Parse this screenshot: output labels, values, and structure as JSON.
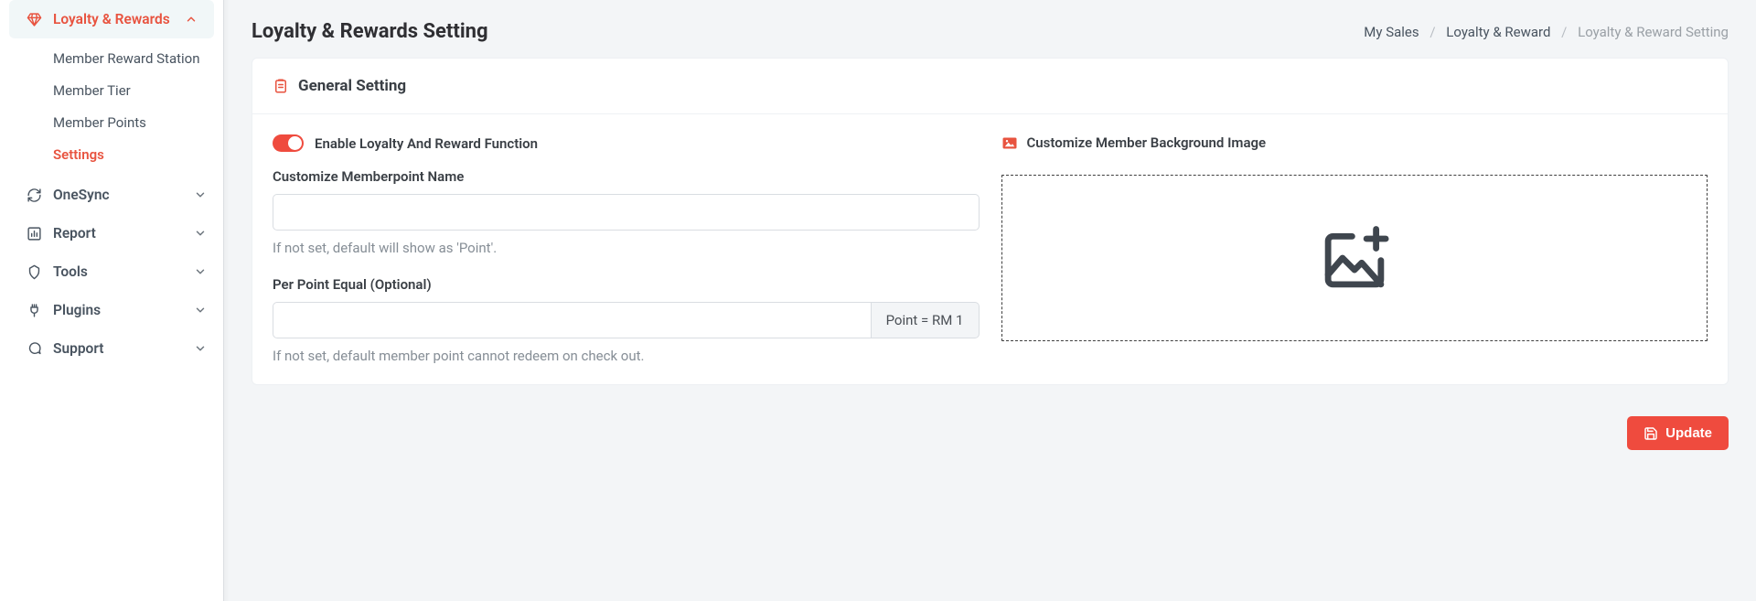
{
  "sidebar": {
    "groups": [
      {
        "key": "loyalty",
        "icon": "diamond",
        "label": "Loyalty & Rewards",
        "expanded": true,
        "active": true,
        "items": [
          {
            "key": "station",
            "label": "Member Reward Station"
          },
          {
            "key": "tier",
            "label": "Member Tier"
          },
          {
            "key": "points",
            "label": "Member Points"
          },
          {
            "key": "settings",
            "label": "Settings",
            "active": true
          }
        ]
      },
      {
        "key": "onesync",
        "icon": "refresh",
        "label": "OneSync"
      },
      {
        "key": "report",
        "icon": "barchart",
        "label": "Report"
      },
      {
        "key": "tools",
        "icon": "toolbox",
        "label": "Tools"
      },
      {
        "key": "plugins",
        "icon": "plug",
        "label": "Plugins"
      },
      {
        "key": "support",
        "icon": "chat",
        "label": "Support"
      }
    ]
  },
  "header": {
    "title": "Loyalty & Rewards Setting",
    "breadcrumb": [
      {
        "label": "My Sales",
        "link": true
      },
      {
        "label": "Loyalty & Reward",
        "link": true
      },
      {
        "label": "Loyalty & Reward Setting",
        "current": true
      }
    ]
  },
  "card": {
    "title": "General Setting",
    "toggle_label": "Enable Loyalty And Reward Function",
    "toggle_on": true,
    "name_label": "Customize Memberpoint Name",
    "name_value": "",
    "name_help": "If not set, default will show as 'Point'.",
    "per_point_label": "Per Point Equal (Optional)",
    "per_point_value": "",
    "per_point_addon": "Point = RM 1",
    "per_point_help": "If not set, default member point cannot redeem on check out.",
    "image_label": "Customize Member Background Image"
  },
  "actions": {
    "update": "Update"
  }
}
